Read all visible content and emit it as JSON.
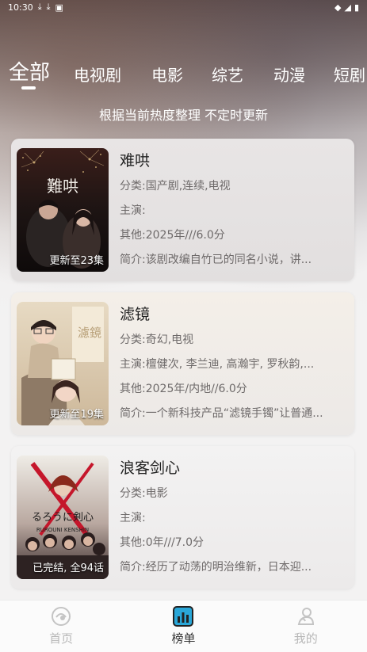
{
  "status": {
    "time": "10:30"
  },
  "tabs": [
    {
      "label": "全部"
    },
    {
      "label": "电视剧"
    },
    {
      "label": "电影"
    },
    {
      "label": "综艺"
    },
    {
      "label": "动漫"
    },
    {
      "label": "短剧"
    }
  ],
  "subtitle": "根据当前热度整理 不定时更新",
  "labels": {
    "category": "分类:",
    "cast": "主演:",
    "other": "其他:",
    "intro": "简介:"
  },
  "items": [
    {
      "title": "难哄",
      "category": "国产剧,连续,电视",
      "cast": "",
      "other": "2025年///6.0分",
      "intro": "该剧改编自竹已的同名小说，讲...",
      "badge": "更新至23集"
    },
    {
      "title": "滤镜",
      "category": "奇幻,电视",
      "cast": "檀健次, 李兰迪, 高瀚宇, 罗秋韵,...",
      "other": "2025年/内地//6.0分",
      "intro": "一个新科技产品“滤镜手镯”让普通...",
      "badge": "更新至19集"
    },
    {
      "title": "浪客剑心",
      "category": "电影",
      "cast": "",
      "other": "0年///7.0分",
      "intro": "经历了动荡的明治维新，日本迎...",
      "badge": "已完结, 全94话"
    }
  ],
  "nav": [
    {
      "label": "首页",
      "icon": "home-icon"
    },
    {
      "label": "榜单",
      "icon": "chart-icon"
    },
    {
      "label": "我的",
      "icon": "user-icon"
    }
  ],
  "colors": {
    "accent": "#2aa7d8",
    "text": "#222222",
    "muted": "#6e6a6a"
  }
}
